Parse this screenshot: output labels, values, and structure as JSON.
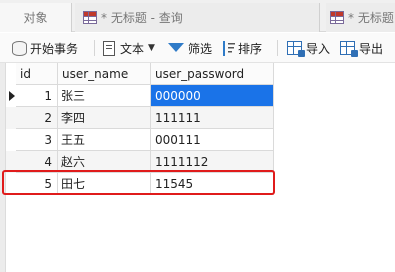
{
  "tabs": {
    "objects_label": "对象",
    "query1_label": "* 无标题 - 查询",
    "query2_label": "* 无标题"
  },
  "toolbar": {
    "begin_transaction": "开始事务",
    "text": "文本",
    "filter": "筛选",
    "sort": "排序",
    "import": "导入",
    "export": "导出"
  },
  "grid": {
    "columns": [
      "id",
      "user_name",
      "user_password"
    ],
    "rows": [
      {
        "id": "1",
        "user_name": "张三",
        "user_password": "000000"
      },
      {
        "id": "2",
        "user_name": "李四",
        "user_password": "111111"
      },
      {
        "id": "3",
        "user_name": "王五",
        "user_password": "000111"
      },
      {
        "id": "4",
        "user_name": "赵六",
        "user_password": "1111112"
      },
      {
        "id": "5",
        "user_name": "田七",
        "user_password": "11545"
      }
    ],
    "selected_row": 1,
    "highlighted_row": 5
  },
  "colors": {
    "selection": "#1a73e8",
    "highlight_border": "#e01b1b"
  }
}
